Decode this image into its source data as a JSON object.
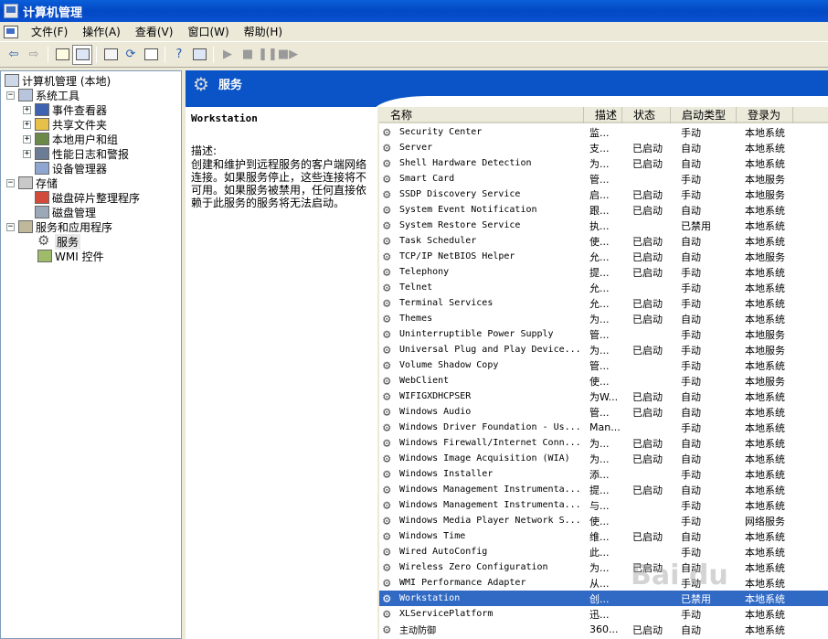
{
  "window": {
    "title": "计算机管理"
  },
  "menu": [
    "文件(F)",
    "操作(A)",
    "查看(V)",
    "窗口(W)",
    "帮助(H)"
  ],
  "toolbar_icons": [
    "back-icon",
    "forward-icon",
    "up-folder-icon",
    "show-hide-tree-icon",
    "properties-icon",
    "refresh-icon",
    "export-list-icon",
    "help-icon",
    "console-icon",
    "start-service-icon",
    "stop-service-icon",
    "pause-service-icon",
    "restart-service-icon"
  ],
  "tree": {
    "root": "计算机管理 (本地)",
    "system_tools": "系统工具",
    "event_viewer": "事件查看器",
    "shared_folders": "共享文件夹",
    "local_users": "本地用户和组",
    "perf_logs": "性能日志和警报",
    "device_manager": "设备管理器",
    "storage": "存储",
    "defrag": "磁盘碎片整理程序",
    "disk_mgmt": "磁盘管理",
    "services_apps": "服务和应用程序",
    "services": "服务",
    "wmi": "WMI 控件"
  },
  "pane": {
    "title": "服务"
  },
  "description": {
    "service_name": "Workstation",
    "label": "描述:",
    "text": "创建和维护到远程服务的客户端网络连接。如果服务停止，这些连接将不可用。如果服务被禁用，任何直接依赖于此服务的服务将无法启动。"
  },
  "columns": {
    "name": "名称",
    "desc": "描述",
    "status": "状态",
    "startup": "启动类型",
    "logon": "登录为"
  },
  "services": [
    {
      "name": "Security Center",
      "desc": "监...",
      "status": "",
      "startup": "手动",
      "logon": "本地系统"
    },
    {
      "name": "Server",
      "desc": "支...",
      "status": "已启动",
      "startup": "自动",
      "logon": "本地系统"
    },
    {
      "name": "Shell Hardware Detection",
      "desc": "为...",
      "status": "已启动",
      "startup": "自动",
      "logon": "本地系统"
    },
    {
      "name": "Smart Card",
      "desc": "管...",
      "status": "",
      "startup": "手动",
      "logon": "本地服务"
    },
    {
      "name": "SSDP Discovery Service",
      "desc": "启...",
      "status": "已启动",
      "startup": "手动",
      "logon": "本地服务"
    },
    {
      "name": "System Event Notification",
      "desc": "跟...",
      "status": "已启动",
      "startup": "自动",
      "logon": "本地系统"
    },
    {
      "name": "System Restore Service",
      "desc": "执...",
      "status": "",
      "startup": "已禁用",
      "logon": "本地系统"
    },
    {
      "name": "Task Scheduler",
      "desc": "使...",
      "status": "已启动",
      "startup": "自动",
      "logon": "本地系统"
    },
    {
      "name": "TCP/IP NetBIOS Helper",
      "desc": "允...",
      "status": "已启动",
      "startup": "自动",
      "logon": "本地服务"
    },
    {
      "name": "Telephony",
      "desc": "提...",
      "status": "已启动",
      "startup": "手动",
      "logon": "本地系统"
    },
    {
      "name": "Telnet",
      "desc": "允...",
      "status": "",
      "startup": "手动",
      "logon": "本地系统"
    },
    {
      "name": "Terminal Services",
      "desc": "允...",
      "status": "已启动",
      "startup": "手动",
      "logon": "本地系统"
    },
    {
      "name": "Themes",
      "desc": "为...",
      "status": "已启动",
      "startup": "自动",
      "logon": "本地系统"
    },
    {
      "name": "Uninterruptible Power Supply",
      "desc": "管...",
      "status": "",
      "startup": "手动",
      "logon": "本地服务"
    },
    {
      "name": "Universal Plug and Play Device...",
      "desc": "为...",
      "status": "已启动",
      "startup": "手动",
      "logon": "本地服务"
    },
    {
      "name": "Volume Shadow Copy",
      "desc": "管...",
      "status": "",
      "startup": "手动",
      "logon": "本地系统"
    },
    {
      "name": "WebClient",
      "desc": "使...",
      "status": "",
      "startup": "手动",
      "logon": "本地服务"
    },
    {
      "name": "WIFIGXDHCPSER",
      "desc": "为W...",
      "status": "已启动",
      "startup": "自动",
      "logon": "本地系统"
    },
    {
      "name": "Windows Audio",
      "desc": "管...",
      "status": "已启动",
      "startup": "自动",
      "logon": "本地系统"
    },
    {
      "name": "Windows Driver Foundation - Us...",
      "desc": "Man...",
      "status": "",
      "startup": "手动",
      "logon": "本地系统"
    },
    {
      "name": "Windows Firewall/Internet Conn...",
      "desc": "为...",
      "status": "已启动",
      "startup": "自动",
      "logon": "本地系统"
    },
    {
      "name": "Windows Image Acquisition (WIA)",
      "desc": "为...",
      "status": "已启动",
      "startup": "自动",
      "logon": "本地系统"
    },
    {
      "name": "Windows Installer",
      "desc": "添...",
      "status": "",
      "startup": "手动",
      "logon": "本地系统"
    },
    {
      "name": "Windows Management Instrumenta...",
      "desc": "提...",
      "status": "已启动",
      "startup": "自动",
      "logon": "本地系统"
    },
    {
      "name": "Windows Management Instrumenta...",
      "desc": "与...",
      "status": "",
      "startup": "手动",
      "logon": "本地系统"
    },
    {
      "name": "Windows Media Player Network S...",
      "desc": "使...",
      "status": "",
      "startup": "手动",
      "logon": "网络服务"
    },
    {
      "name": "Windows Time",
      "desc": "维...",
      "status": "已启动",
      "startup": "自动",
      "logon": "本地系统"
    },
    {
      "name": "Wired AutoConfig",
      "desc": "此...",
      "status": "",
      "startup": "手动",
      "logon": "本地系统"
    },
    {
      "name": "Wireless Zero Configuration",
      "desc": "为...",
      "status": "已启动",
      "startup": "自动",
      "logon": "本地系统"
    },
    {
      "name": "WMI Performance Adapter",
      "desc": "从...",
      "status": "",
      "startup": "手动",
      "logon": "本地系统"
    },
    {
      "name": "Workstation",
      "desc": "创...",
      "status": "",
      "startup": "已禁用",
      "logon": "本地系统",
      "selected": true
    },
    {
      "name": "XLServicePlatform",
      "desc": "迅...",
      "status": "",
      "startup": "手动",
      "logon": "本地系统"
    },
    {
      "name": "主动防御",
      "desc": "360...",
      "status": "已启动",
      "startup": "自动",
      "logon": "本地系统"
    }
  ],
  "watermark": "Bai du"
}
